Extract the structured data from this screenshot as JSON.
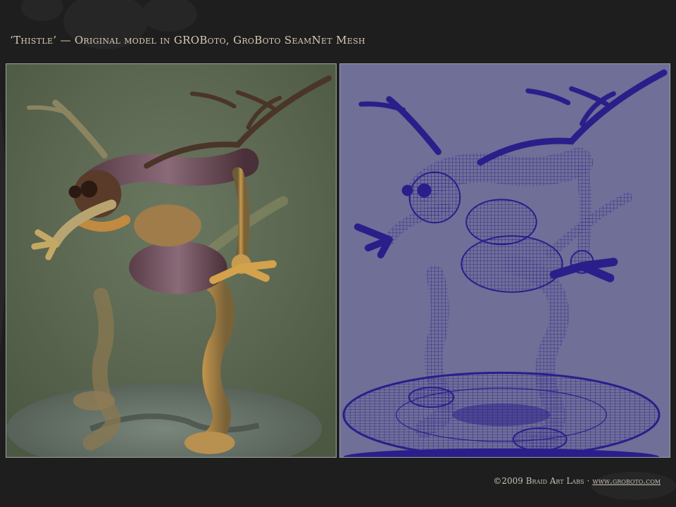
{
  "header": {
    "title": "‘Thistle’ — Original model in GROBoto, GroBoto SeamNet Mesh"
  },
  "panels": {
    "left": {
      "icon": "shaded-render-image"
    },
    "right": {
      "icon": "wireframe-mesh-image"
    }
  },
  "footer": {
    "copyright": "©2009 Braid Art Labs",
    "separator": "·",
    "url": "www.groboto.com"
  },
  "colors": {
    "background": "#1e1e1e",
    "left_panel_bg": "#5e6a52",
    "right_panel_bg": "#6f6f98",
    "mesh_line": "#2a1e8a",
    "title_text": "#d8ccb4"
  }
}
